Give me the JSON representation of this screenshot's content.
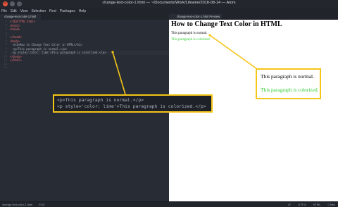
{
  "window": {
    "title": "change-text-color-1.html — ~/Documents/Work/Lifewire/2018-08-14 — Atom"
  },
  "window_buttons": [
    "×",
    "–",
    "□"
  ],
  "menu": [
    "File",
    "Edit",
    "View",
    "Selection",
    "Find",
    "Packages",
    "Help"
  ],
  "editor": {
    "tab_label": "change-text-color-1.html",
    "line_numbers": [
      "1",
      "2",
      "3",
      "4",
      "5",
      "6",
      "7",
      "8",
      "9",
      "10",
      "11",
      "12",
      "13"
    ],
    "lines": [
      "<!DOCTYPE html>",
      "<html>",
      "<head>",
      "",
      "</head>",
      "<body>",
      "<h1>How to Change Text Color in HTML</h1>",
      "<p>This paragraph is normal.</p>",
      "<p style='color: lime'>This paragraph is colorized.</p>",
      "</body>",
      "</html>",
      "",
      ""
    ]
  },
  "preview": {
    "tab_label": "change-text-color-1.html Preview",
    "heading": "How to Change Text Color in HTML",
    "paragraph_normal": "This paragraph is normal.",
    "paragraph_colorized": "This paragraph is colorized.",
    "colorized_color": "#32cd32"
  },
  "callout_code": {
    "line1": "<p>This paragraph is normal.</p>",
    "line2": "<p style='color: lime'>This paragraph is colorized.</p>"
  },
  "callout_preview": {
    "line1": "This paragraph is normal.",
    "line2": "This paragraph is colorized."
  },
  "statusbar": {
    "file": "change-text-color-1.html",
    "position": "9:24",
    "line_ending": "LF",
    "encoding": "UTF-8",
    "grammar": "HTML",
    "files": "0 files"
  },
  "colors": {
    "accent_highlight": "#f5c518",
    "lime": "#32cd32"
  }
}
